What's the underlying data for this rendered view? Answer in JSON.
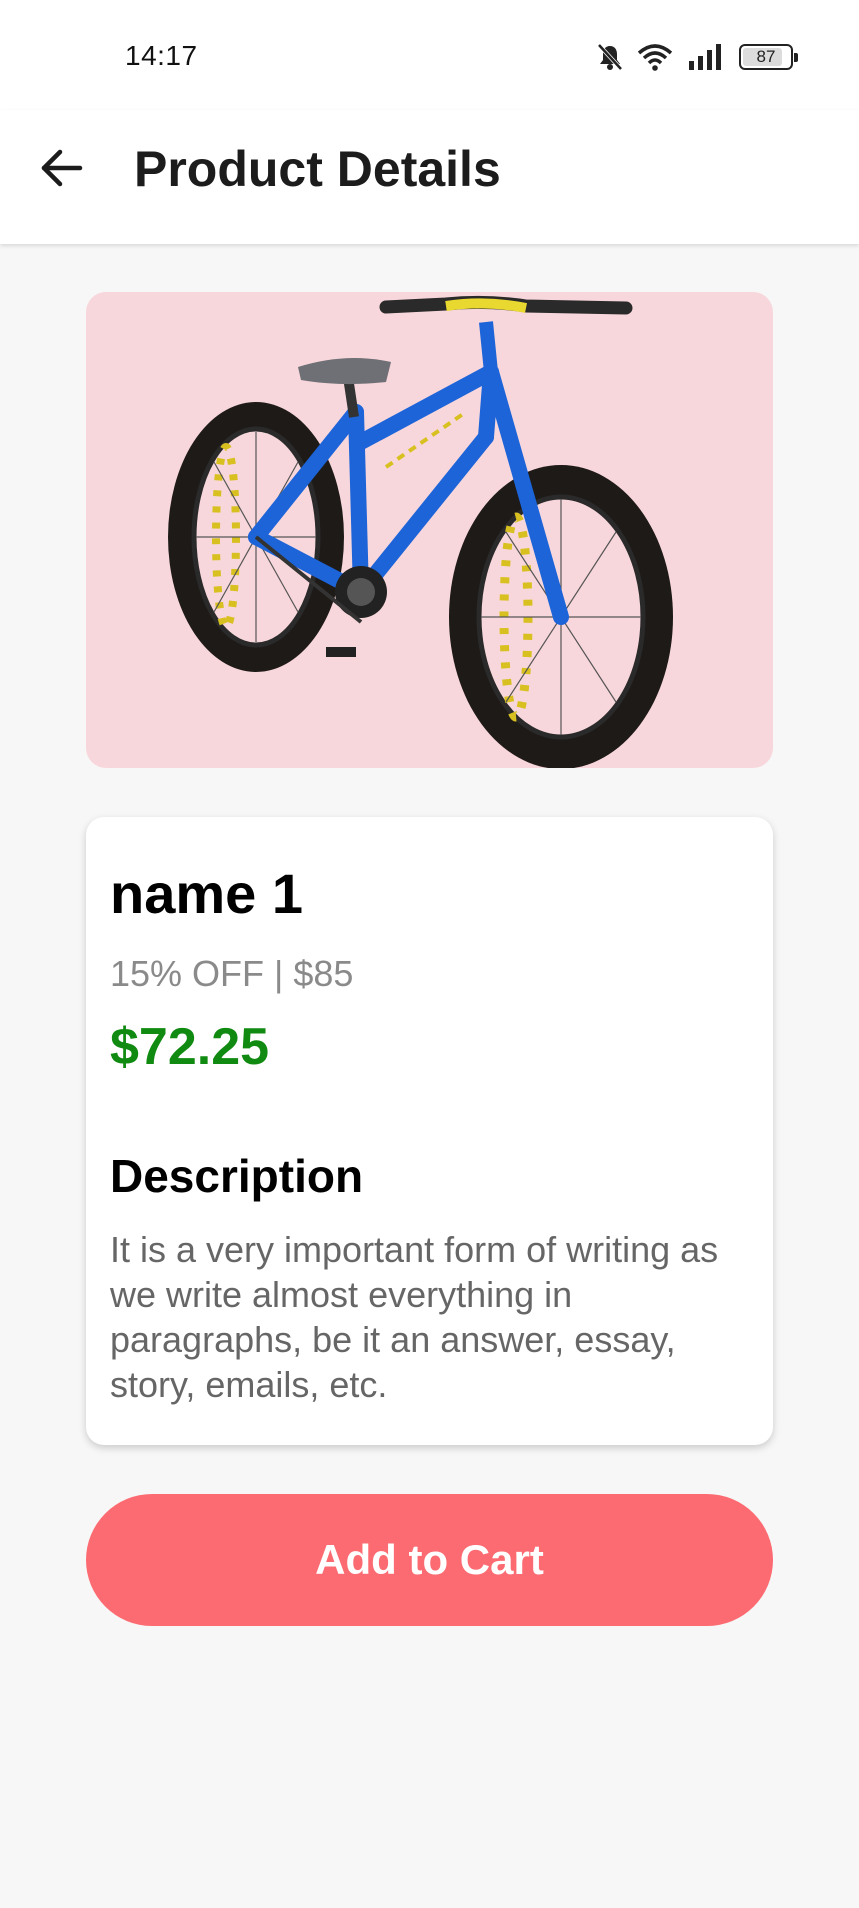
{
  "status_bar": {
    "time": "14:17",
    "battery_level": "87",
    "icons": [
      "bell-off-icon",
      "wifi-icon",
      "signal-icon",
      "battery-icon"
    ]
  },
  "header": {
    "title": "Product Details",
    "back_icon": "arrow-left-icon"
  },
  "product": {
    "image_icon": "fat-tire-bicycle",
    "name": "name 1",
    "discount_line": "15% OFF | $85",
    "price": "$72.25",
    "description_heading": "Description",
    "description": "It is a very important form of writing as we write almost everything in paragraphs, be it an answer, essay, story, emails, etc."
  },
  "actions": {
    "add_to_cart_label": "Add to Cart"
  },
  "colors": {
    "price_green": "#118a11",
    "button_red": "#fc6b72",
    "image_background": "#f8d7dc",
    "page_background": "#f7f7f7"
  }
}
